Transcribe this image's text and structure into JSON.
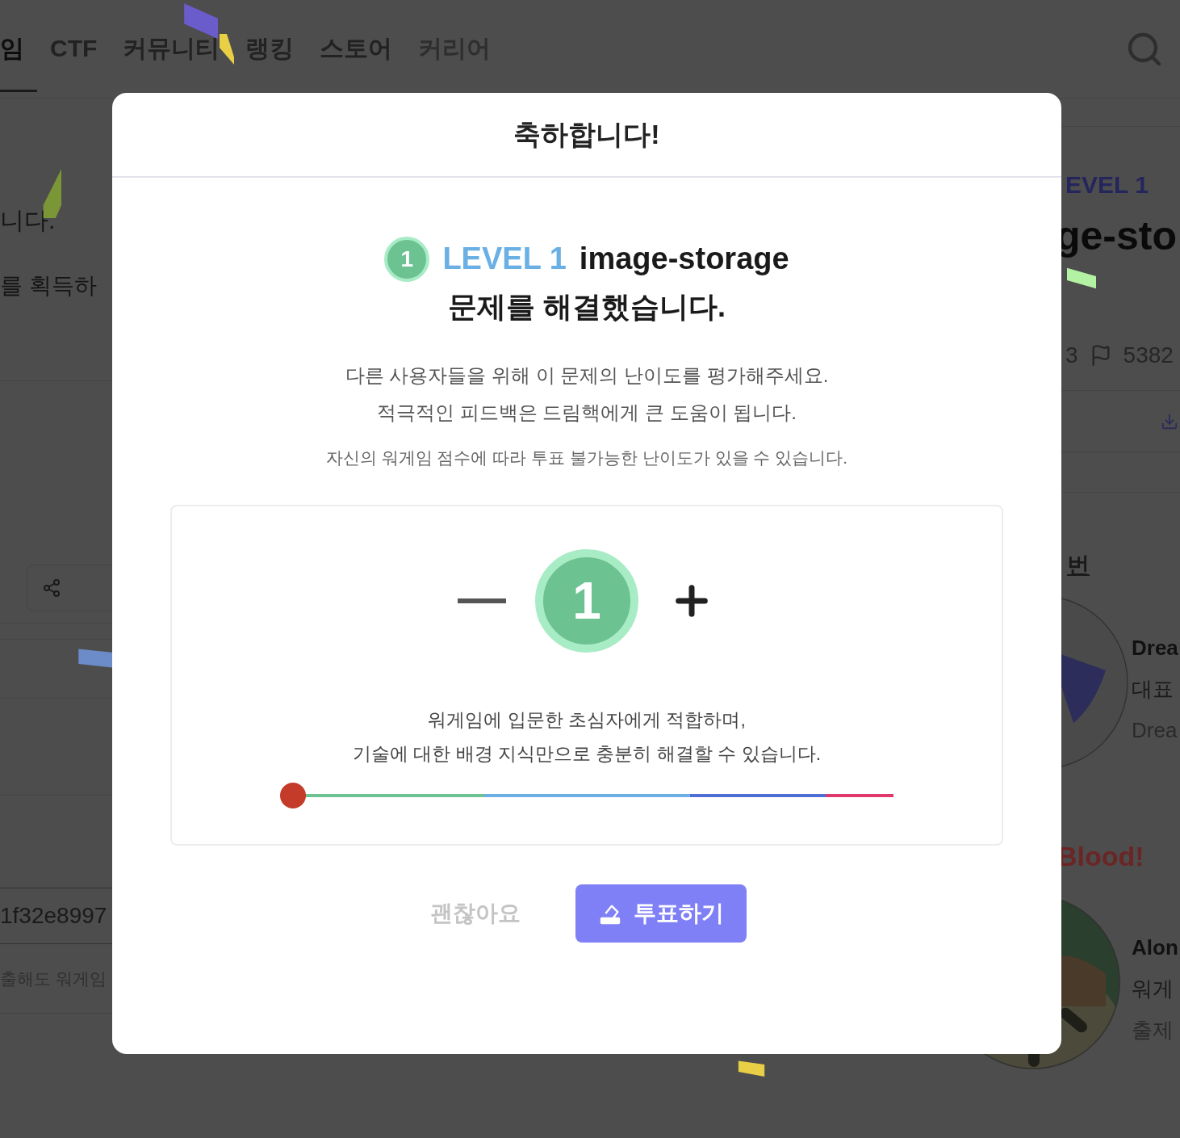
{
  "nav": {
    "tabs": [
      {
        "label": "임",
        "selected": true,
        "disabled": false
      },
      {
        "label": "CTF",
        "selected": false,
        "disabled": false
      },
      {
        "label": "커뮤니티",
        "selected": false,
        "disabled": false
      },
      {
        "label": "랭킹",
        "selected": false,
        "disabled": false
      },
      {
        "label": "스토어",
        "selected": false,
        "disabled": false
      },
      {
        "label": "커리어",
        "selected": false,
        "disabled": true
      }
    ]
  },
  "page": {
    "left_lines": [
      "니다.",
      "를 획득하"
    ],
    "hash": "1f32e8997",
    "hint": "출해도 워게임",
    "challenge_level": "EVEL 1",
    "challenge_title": "ge-sto",
    "solvers": "3",
    "flags": "5382",
    "section_heading": "번",
    "authors": [
      {
        "name": "Drea",
        "role": "대표",
        "team": "Drea"
      }
    ],
    "first_blood": "Blood!",
    "blood_user": {
      "name": "Alon",
      "line_2": "워게",
      "line_3": "출제"
    }
  },
  "modal": {
    "title": "축하합니다!",
    "level_badge": "1",
    "level_label": "LEVEL 1",
    "challenge": "image-storage",
    "solved_text": "문제를 해결했습니다.",
    "prompt_lines": [
      "다른 사용자들을 위해 이 문제의 난이도를 평가해주세요.",
      "적극적인 피드백은 드림핵에게 큰 도움이 됩니다."
    ],
    "note": "자신의 워게임 점수에 따라 투표 불가능한 난이도가 있을 수 있습니다.",
    "rating": {
      "value": "1",
      "color": "#6cc290",
      "description_lines": [
        "워게임에 입문한 초심자에게 적합하며,",
        "기술에 대한 배경 지식만으로 충분히 해결할 수 있습니다."
      ],
      "level": 0
    },
    "buttons": [
      {
        "label": "괜찮아요",
        "kind": "text"
      },
      {
        "label": "투표하기",
        "kind": "primary"
      }
    ]
  }
}
